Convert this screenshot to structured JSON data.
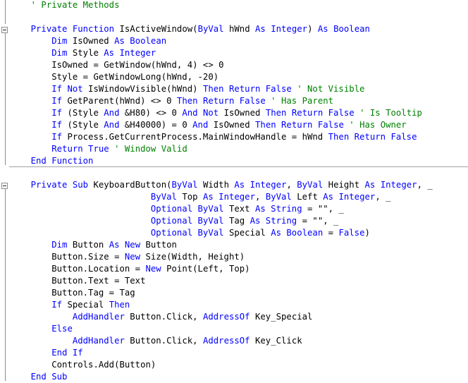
{
  "colors": {
    "keyword": "#0000ff",
    "comment": "#008000",
    "text": "#000000",
    "background": "#ffffff"
  },
  "icons": [
    "collapse-icon"
  ],
  "lines": [
    [
      [
        "cm",
        "    ' Private Methods"
      ]
    ],
    [
      [
        "tx",
        ""
      ]
    ],
    [
      [
        "tx",
        "    "
      ],
      [
        "kw",
        "Private Function"
      ],
      [
        "tx",
        " IsActiveWindow("
      ],
      [
        "kw",
        "ByVal"
      ],
      [
        "tx",
        " hWnd "
      ],
      [
        "kw",
        "As Integer"
      ],
      [
        "tx",
        ") "
      ],
      [
        "kw",
        "As Boolean"
      ]
    ],
    [
      [
        "tx",
        "        "
      ],
      [
        "kw",
        "Dim"
      ],
      [
        "tx",
        " IsOwned "
      ],
      [
        "kw",
        "As Boolean"
      ]
    ],
    [
      [
        "tx",
        "        "
      ],
      [
        "kw",
        "Dim"
      ],
      [
        "tx",
        " Style "
      ],
      [
        "kw",
        "As Integer"
      ]
    ],
    [
      [
        "tx",
        "        IsOwned = GetWindow(hWnd, 4) <> 0"
      ]
    ],
    [
      [
        "tx",
        "        Style = GetWindowLong(hWnd, -20)"
      ]
    ],
    [
      [
        "tx",
        "        "
      ],
      [
        "kw",
        "If Not"
      ],
      [
        "tx",
        " IsWindowVisible(hWnd) "
      ],
      [
        "kw",
        "Then Return False"
      ],
      [
        "cm",
        " ' Not Visible"
      ]
    ],
    [
      [
        "tx",
        "        "
      ],
      [
        "kw",
        "If"
      ],
      [
        "tx",
        " GetParent(hWnd) <> 0 "
      ],
      [
        "kw",
        "Then Return False"
      ],
      [
        "cm",
        " ' Has Parent"
      ]
    ],
    [
      [
        "tx",
        "        "
      ],
      [
        "kw",
        "If"
      ],
      [
        "tx",
        " (Style "
      ],
      [
        "kw",
        "And"
      ],
      [
        "tx",
        " &H80) <> 0 "
      ],
      [
        "kw",
        "And Not"
      ],
      [
        "tx",
        " IsOwned "
      ],
      [
        "kw",
        "Then Return False"
      ],
      [
        "cm",
        " ' Is Tooltip"
      ]
    ],
    [
      [
        "tx",
        "        "
      ],
      [
        "kw",
        "If"
      ],
      [
        "tx",
        " (Style "
      ],
      [
        "kw",
        "And"
      ],
      [
        "tx",
        " &H40000) = 0 "
      ],
      [
        "kw",
        "And"
      ],
      [
        "tx",
        " IsOwned "
      ],
      [
        "kw",
        "Then Return False"
      ],
      [
        "cm",
        " ' Has Owner"
      ]
    ],
    [
      [
        "tx",
        "        "
      ],
      [
        "kw",
        "If"
      ],
      [
        "tx",
        " Process.GetCurrentProcess.MainWindowHandle = hWnd "
      ],
      [
        "kw",
        "Then Return False"
      ]
    ],
    [
      [
        "tx",
        "        "
      ],
      [
        "kw",
        "Return True"
      ],
      [
        "cm",
        " ' Window Valid"
      ]
    ],
    [
      [
        "tx",
        "    "
      ],
      [
        "kw",
        "End Function"
      ]
    ],
    [
      [
        "tx",
        ""
      ]
    ],
    [
      [
        "tx",
        "    "
      ],
      [
        "kw",
        "Private Sub"
      ],
      [
        "tx",
        " KeyboardButton("
      ],
      [
        "kw",
        "ByVal"
      ],
      [
        "tx",
        " Width "
      ],
      [
        "kw",
        "As Integer"
      ],
      [
        "tx",
        ", "
      ],
      [
        "kw",
        "ByVal"
      ],
      [
        "tx",
        " Height "
      ],
      [
        "kw",
        "As Integer"
      ],
      [
        "tx",
        ", _"
      ]
    ],
    [
      [
        "tx",
        "                           "
      ],
      [
        "kw",
        "ByVal"
      ],
      [
        "tx",
        " Top "
      ],
      [
        "kw",
        "As Integer"
      ],
      [
        "tx",
        ", "
      ],
      [
        "kw",
        "ByVal"
      ],
      [
        "tx",
        " Left "
      ],
      [
        "kw",
        "As Integer"
      ],
      [
        "tx",
        ", _"
      ]
    ],
    [
      [
        "tx",
        "                           "
      ],
      [
        "kw",
        "Optional ByVal"
      ],
      [
        "tx",
        " Text "
      ],
      [
        "kw",
        "As String"
      ],
      [
        "tx",
        " = \"\", _"
      ]
    ],
    [
      [
        "tx",
        "                           "
      ],
      [
        "kw",
        "Optional ByVal"
      ],
      [
        "tx",
        " Tag "
      ],
      [
        "kw",
        "As String"
      ],
      [
        "tx",
        " = \"\", _"
      ]
    ],
    [
      [
        "tx",
        "                           "
      ],
      [
        "kw",
        "Optional ByVal"
      ],
      [
        "tx",
        " Special "
      ],
      [
        "kw",
        "As Boolean"
      ],
      [
        "tx",
        " = "
      ],
      [
        "kw",
        "False"
      ],
      [
        "tx",
        ")"
      ]
    ],
    [
      [
        "tx",
        "        "
      ],
      [
        "kw",
        "Dim"
      ],
      [
        "tx",
        " Button "
      ],
      [
        "kw",
        "As New"
      ],
      [
        "tx",
        " Button"
      ]
    ],
    [
      [
        "tx",
        "        Button.Size = "
      ],
      [
        "kw",
        "New"
      ],
      [
        "tx",
        " Size(Width, Height)"
      ]
    ],
    [
      [
        "tx",
        "        Button.Location = "
      ],
      [
        "kw",
        "New"
      ],
      [
        "tx",
        " Point(Left, Top)"
      ]
    ],
    [
      [
        "tx",
        "        Button.Text = Text"
      ]
    ],
    [
      [
        "tx",
        "        Button.Tag = Tag"
      ]
    ],
    [
      [
        "tx",
        "        "
      ],
      [
        "kw",
        "If"
      ],
      [
        "tx",
        " Special "
      ],
      [
        "kw",
        "Then"
      ]
    ],
    [
      [
        "tx",
        "            "
      ],
      [
        "kw",
        "AddHandler"
      ],
      [
        "tx",
        " Button.Click, "
      ],
      [
        "kw",
        "AddressOf"
      ],
      [
        "tx",
        " Key_Special"
      ]
    ],
    [
      [
        "tx",
        "        "
      ],
      [
        "kw",
        "Else"
      ]
    ],
    [
      [
        "tx",
        "            "
      ],
      [
        "kw",
        "AddHandler"
      ],
      [
        "tx",
        " Button.Click, "
      ],
      [
        "kw",
        "AddressOf"
      ],
      [
        "tx",
        " Key_Click"
      ]
    ],
    [
      [
        "tx",
        "        "
      ],
      [
        "kw",
        "End If"
      ]
    ],
    [
      [
        "tx",
        "        Controls.Add(Button)"
      ]
    ],
    [
      [
        "tx",
        "    "
      ],
      [
        "kw",
        "End Sub"
      ]
    ]
  ]
}
